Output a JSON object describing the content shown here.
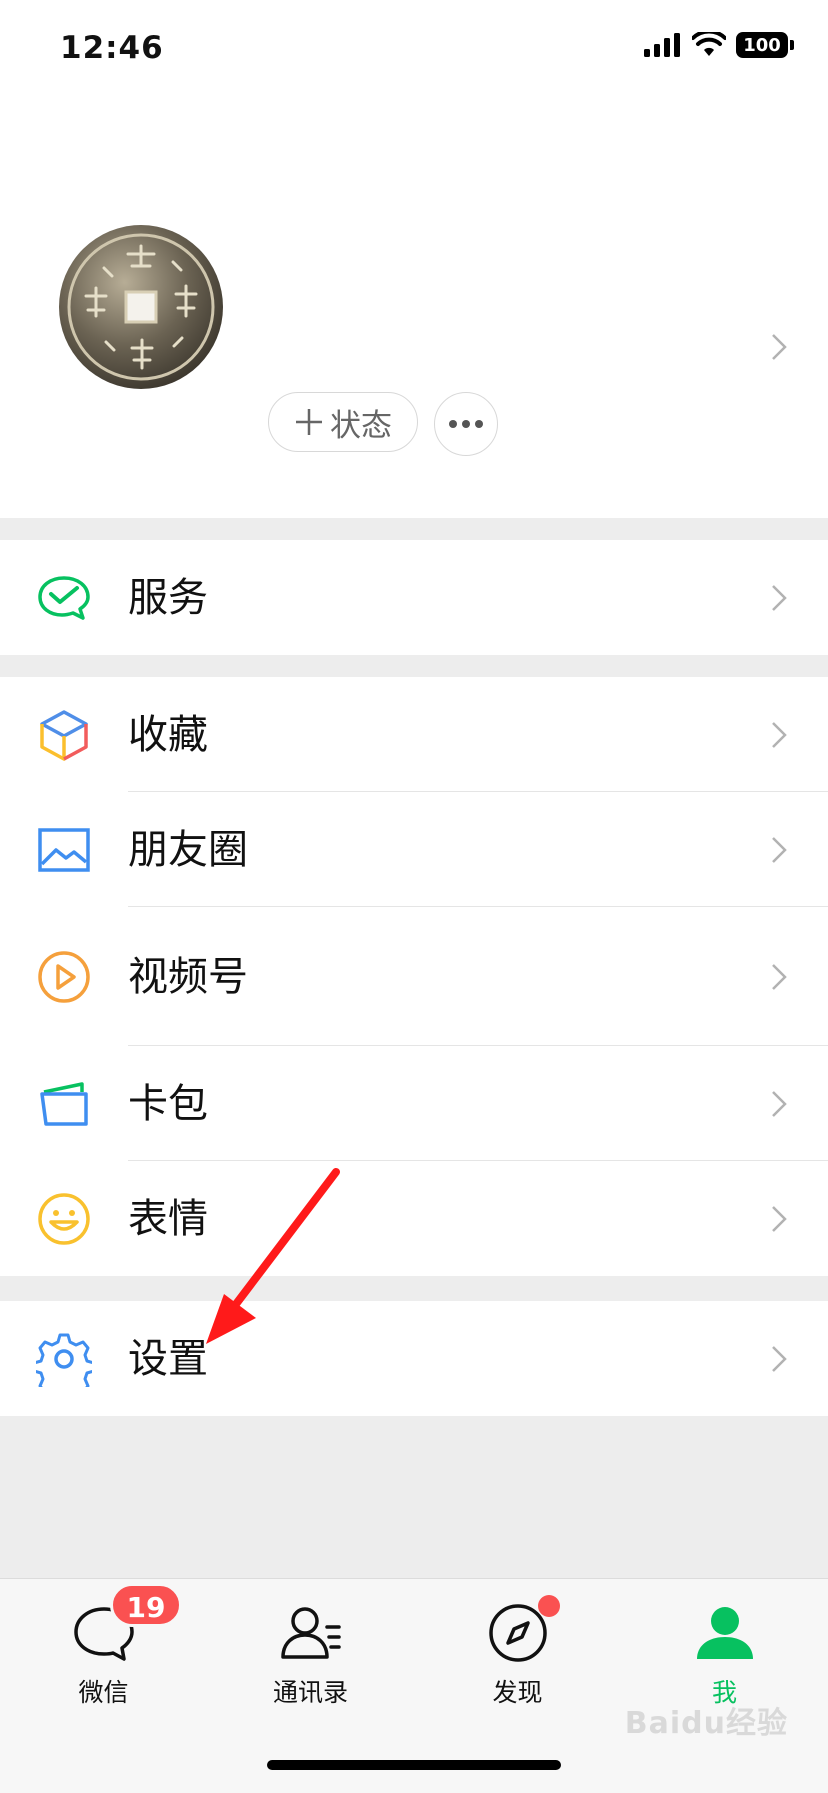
{
  "status_bar": {
    "time": "12:46",
    "battery": "100"
  },
  "profile": {
    "status_button": "状态"
  },
  "menu": {
    "services": "服务",
    "items": [
      {
        "label": "收藏",
        "icon": "favorites-cube-icon"
      },
      {
        "label": "朋友圈",
        "icon": "moments-image-icon"
      },
      {
        "label": "视频号",
        "icon": "channels-play-icon"
      },
      {
        "label": "卡包",
        "icon": "card-wallet-icon"
      },
      {
        "label": "表情",
        "icon": "sticker-smiley-icon"
      }
    ],
    "settings": "设置"
  },
  "tabbar": {
    "tabs": [
      {
        "label": "微信",
        "badge": "19"
      },
      {
        "label": "通讯录"
      },
      {
        "label": "发现"
      },
      {
        "label": "我"
      }
    ]
  },
  "watermark": "Baidu经验",
  "colors": {
    "accent_green": "#07c160",
    "badge_red": "#fa5151",
    "arrow_red": "#ff1a1a"
  }
}
